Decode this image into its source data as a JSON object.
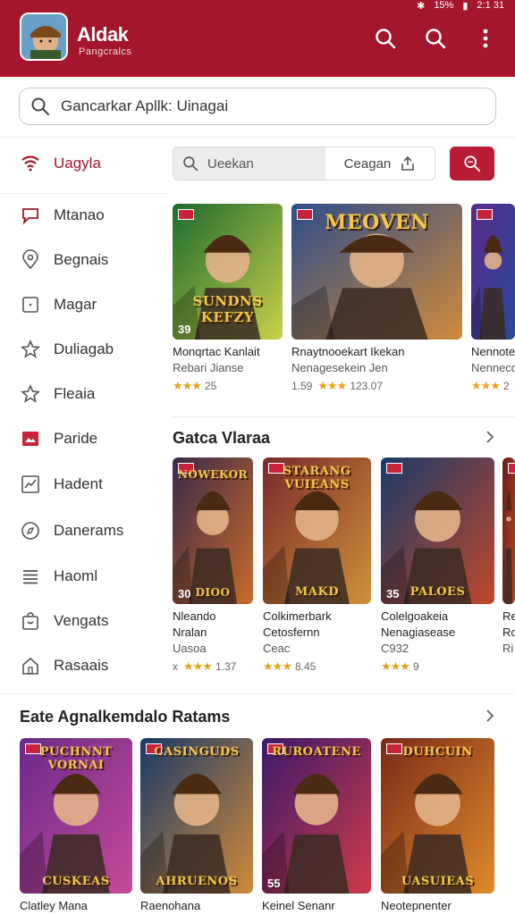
{
  "status": {
    "battery": "15%",
    "time": "2:1 31"
  },
  "header": {
    "title": "Aldak",
    "subtitle": "Pangcralcs"
  },
  "search": {
    "placeholder": "Gancarkar Apllk: Uinagai"
  },
  "sidebar": {
    "items": [
      {
        "label": "Uagyla",
        "icon": "wifi-icon"
      },
      {
        "label": "Mtanao",
        "icon": "chat-icon"
      },
      {
        "label": "Begnais",
        "icon": "location-icon"
      },
      {
        "label": "Magar",
        "icon": "square-icon"
      },
      {
        "label": "Duliagab",
        "icon": "star-outline-icon"
      },
      {
        "label": "Fleaia",
        "icon": "star-icon"
      },
      {
        "label": "Paride",
        "icon": "image-icon"
      },
      {
        "label": "Hadent",
        "icon": "chart-icon"
      },
      {
        "label": "Danerams",
        "icon": "compass-icon"
      },
      {
        "label": "Haoml",
        "icon": "list-icon"
      },
      {
        "label": "Vengats",
        "icon": "bag-icon"
      },
      {
        "label": "Rasaais",
        "icon": "home-icon"
      }
    ]
  },
  "filter": {
    "left_label": "Ueekan",
    "right_label": "Ceagan"
  },
  "featured": [
    {
      "title_art": "SUNDNS KEFZY",
      "num": "39",
      "name": "Monqrtac Kanlait",
      "sub": "Rebari Jianse",
      "rating": "25",
      "colors": [
        "#1d6b2e",
        "#c8d04a"
      ]
    },
    {
      "title_art": "MEOVEN",
      "num": "",
      "name": "Rnaytnooekart Ikekan",
      "sub": "Nenagesekein Jen",
      "rating": "123.07",
      "prefix": "1.59",
      "colors": [
        "#2d4d8a",
        "#d08a3a"
      ]
    },
    {
      "title_art": "",
      "num": "",
      "name": "Nennote",
      "sub": "Nenneco",
      "rating": "2",
      "colors": [
        "#5a2a8a",
        "#2a4a9a"
      ]
    }
  ],
  "section2": {
    "title": "Gatca Vlaraa",
    "cards": [
      {
        "title_art": "NOWEKOR",
        "bottom_art": "DIOO",
        "num": "30",
        "name": "Nleando",
        "line2": "Nralan",
        "sub": "Uasoa",
        "rating": "1.37",
        "prefix": "x",
        "colors": [
          "#3a2a4a",
          "#c96a2a"
        ]
      },
      {
        "title_art": "STARANG VUIEANS",
        "bottom_art": "MAKD",
        "num": "",
        "name": "Colkimerbark",
        "line2": "Cetosfernn",
        "sub": "Ceac",
        "rating": "8.45",
        "colors": [
          "#7a2a2a",
          "#d0903a"
        ]
      },
      {
        "title_art": "",
        "bottom_art": "PALOES",
        "num": "35",
        "name": "Colelgoakeia",
        "line2": "Nenagiasease",
        "sub": "C932",
        "rating": "9",
        "colors": [
          "#1a3a6a",
          "#c0482a"
        ]
      },
      {
        "title_art": "",
        "bottom_art": "",
        "num": "",
        "name": "Re",
        "line2": "Rc",
        "sub": "Ri",
        "rating": "",
        "colors": [
          "#6a1a1a",
          "#b04a2a"
        ]
      }
    ]
  },
  "section3": {
    "title": "Eate Agnalkemdalo Ratams",
    "cards": [
      {
        "title_art": "PUCHNNT VORNAI",
        "bottom_art": "CUSKEAS",
        "name": "Clatley Mana",
        "colors": [
          "#6a2a8a",
          "#c84a9a"
        ]
      },
      {
        "title_art": "CASINGUDS",
        "bottom_art": "AHRUENOS",
        "name": "Raenohana",
        "colors": [
          "#1a3a6a",
          "#d08a3a"
        ]
      },
      {
        "title_art": "RUROATENE",
        "bottom_art": "",
        "num": "55",
        "name": "Keinel Senanr",
        "colors": [
          "#3a1a6a",
          "#d03a4a"
        ]
      },
      {
        "title_art": "DUHCUIN",
        "bottom_art": "UASUIEAS",
        "name": "Neotepnenter",
        "colors": [
          "#7a2a1a",
          "#e08a2a"
        ]
      }
    ]
  },
  "accent": "#a4162c"
}
